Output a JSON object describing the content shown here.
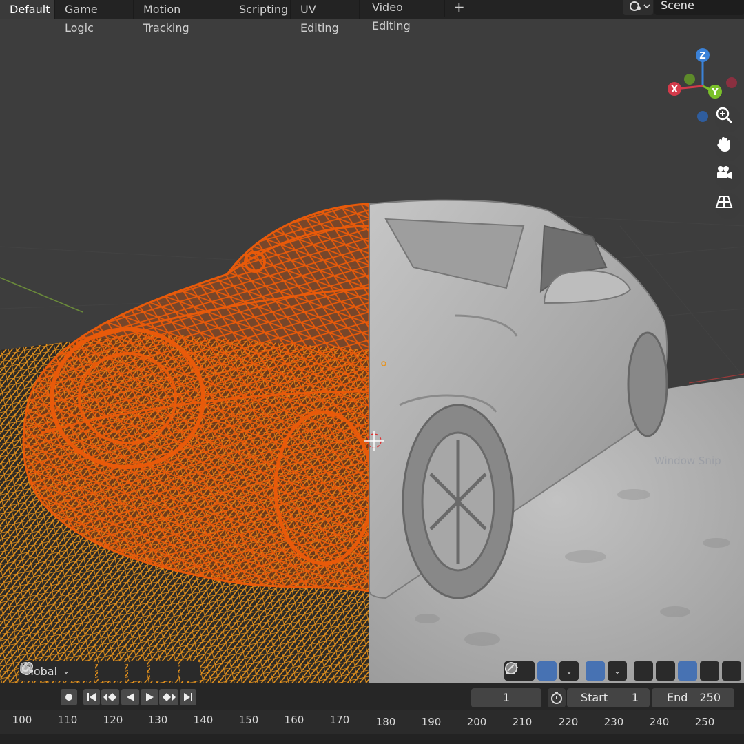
{
  "workspace_tabs": [
    "Default",
    "Game Logic",
    "Motion Tracking",
    "Scripting",
    "UV Editing",
    "Video Editing"
  ],
  "add_tab_label": "+",
  "scene": {
    "label": "Scene"
  },
  "gizmo": {
    "x": "X",
    "y": "Y",
    "z": "Z"
  },
  "nav_icons": [
    "zoom-icon",
    "hand-pan-icon",
    "camera-icon",
    "perspective-grid-icon"
  ],
  "header_left": {
    "orientation": "Global"
  },
  "playback": {
    "current_frame": "1",
    "start_label": "Start",
    "start_value": "1",
    "end_label": "End",
    "end_value": "250"
  },
  "ruler_left": [
    "100",
    "110",
    "120",
    "130",
    "140",
    "150",
    "160",
    "170"
  ],
  "ruler_right": [
    "180",
    "190",
    "200",
    "210",
    "220",
    "230",
    "240",
    "250"
  ],
  "watermark": "Window Snip",
  "colors": {
    "wire": "#e85a0a",
    "floor_wire": "#e8941d",
    "viewport_bg": "#3d3d3d",
    "solid": "#b4b4b4",
    "active_blue": "#4772b3"
  }
}
